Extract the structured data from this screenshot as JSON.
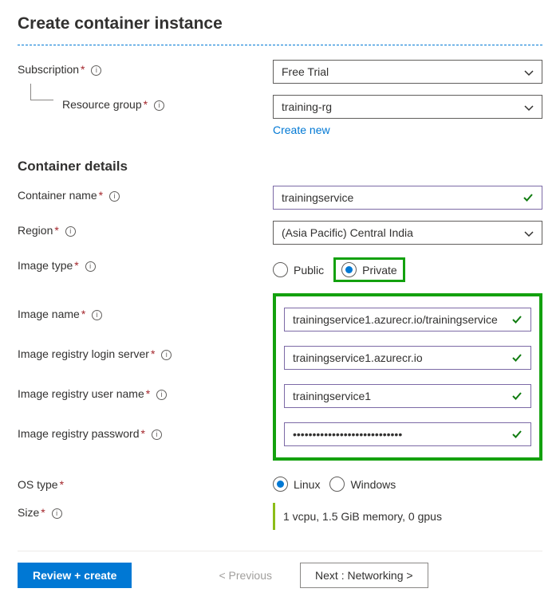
{
  "title": "Create container instance",
  "subscription": {
    "label": "Subscription",
    "value": "Free Trial"
  },
  "resource_group": {
    "label": "Resource group",
    "value": "training-rg",
    "create_new": "Create new"
  },
  "container_details_heading": "Container details",
  "container_name": {
    "label": "Container name",
    "value": "trainingservice"
  },
  "region": {
    "label": "Region",
    "value": "(Asia Pacific) Central India"
  },
  "image_type": {
    "label": "Image type",
    "public": "Public",
    "private": "Private",
    "selected": "Private"
  },
  "image_name": {
    "label": "Image name",
    "value": "trainingservice1.azurecr.io/trainingservice"
  },
  "login_server": {
    "label": "Image registry login server",
    "value": "trainingservice1.azurecr.io"
  },
  "user_name": {
    "label": "Image registry user name",
    "value": "trainingservice1"
  },
  "password": {
    "label": "Image registry password",
    "value": "••••••••••••••••••••••••••••"
  },
  "os_type": {
    "label": "OS type",
    "linux": "Linux",
    "windows": "Windows",
    "selected": "Linux"
  },
  "size": {
    "label": "Size",
    "value": "1 vcpu, 1.5 GiB memory, 0 gpus"
  },
  "footer": {
    "review": "Review + create",
    "previous": "< Previous",
    "next": "Next : Networking >"
  }
}
